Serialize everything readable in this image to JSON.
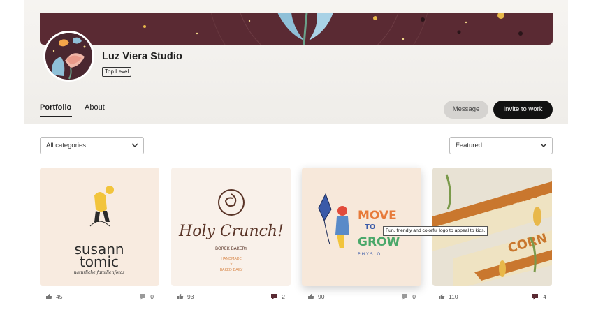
{
  "profile": {
    "name": "Luz Viera Studio",
    "level_badge": "Top Level"
  },
  "tabs": [
    {
      "label": "Portfolio",
      "active": true
    },
    {
      "label": "About",
      "active": false
    }
  ],
  "actions": {
    "message_label": "Message",
    "invite_label": "Invite to work"
  },
  "filters": {
    "category_selected": "All categories",
    "sort_selected": "Featured"
  },
  "cards": [
    {
      "artwork": "susann-tomic-logo",
      "likes": "45",
      "comments": "0",
      "comment_icon_color": "#9a9a9a"
    },
    {
      "artwork": "holy-crunch-logo",
      "likes": "93",
      "comments": "2",
      "comment_icon_color": "#5a2a33"
    },
    {
      "artwork": "move-to-grow-logo",
      "likes": "90",
      "comments": "0",
      "comment_icon_color": "#9a9a9a"
    },
    {
      "artwork": "corn-packaging",
      "likes": "110",
      "comments": "4",
      "comment_icon_color": "#5a2a33"
    }
  ],
  "tooltip": {
    "text": "Fun, friendly and colorful logo to appeal to kids."
  },
  "colors": {
    "banner": "#5a2a33",
    "primary_button": "#111111",
    "secondary_button": "#d5d3d0"
  }
}
